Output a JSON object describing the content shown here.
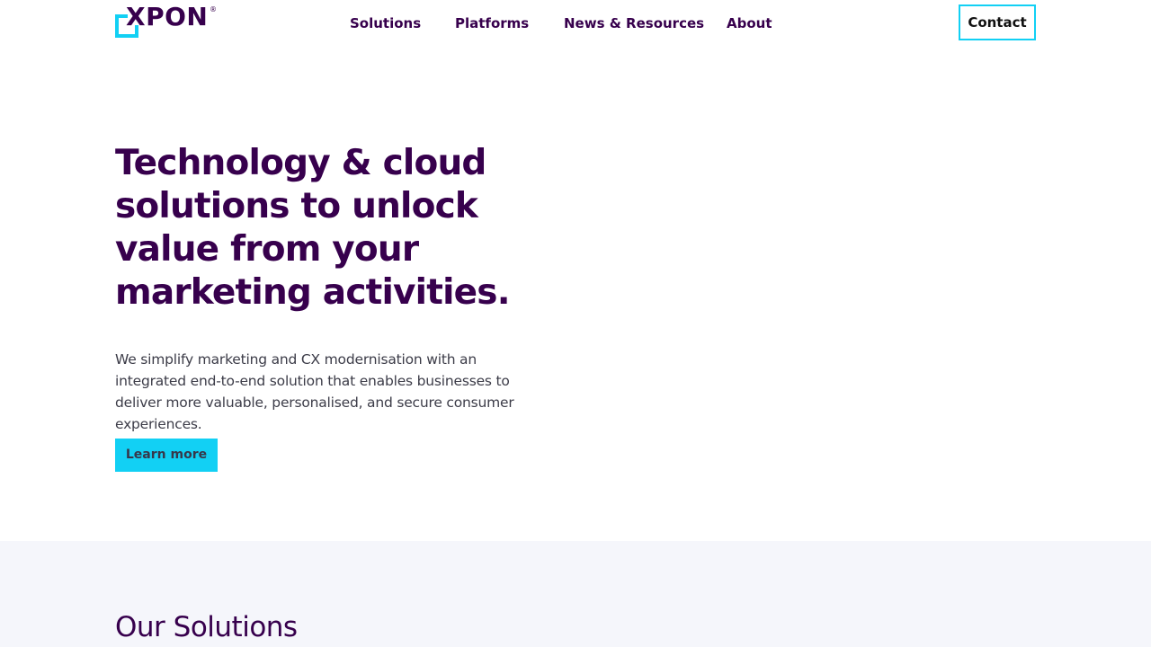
{
  "header": {
    "logo_text": "XPON",
    "logo_mark": "®",
    "nav": [
      {
        "label": "Solutions"
      },
      {
        "label": "Platforms"
      },
      {
        "label": "News & Resources"
      },
      {
        "label": "About"
      }
    ],
    "contact_label": "Contact"
  },
  "hero": {
    "title": "Technology & cloud solutions to unlock value from your marketing activities.",
    "description": "We simplify marketing and CX modernisation with an integrated end-to-end solution that enables businesses to deliver more valuable, personalised, and secure consumer experiences.",
    "cta_label": "Learn more"
  },
  "solutions": {
    "title": "Our Solutions"
  },
  "colors": {
    "brand_purple": "#37004d",
    "accent_cyan": "#12d0f4",
    "section_bg": "#f5f6fb",
    "body_text": "#3c3c48"
  },
  "icons": {
    "logo": "xpon-logo-icon"
  }
}
